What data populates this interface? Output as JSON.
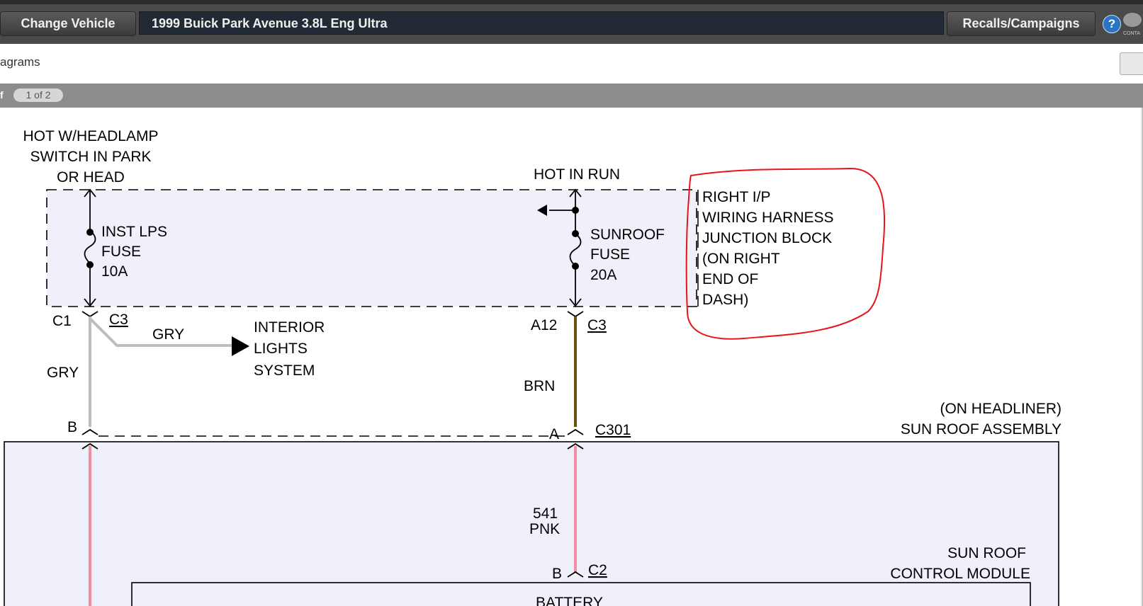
{
  "toolbar": {
    "change_vehicle": "Change Vehicle",
    "vehicle": "1999 Buick Park Avenue 3.8L Eng Ultra",
    "recalls": "Recalls/Campaigns",
    "help": "?",
    "chat_label": "CONTA"
  },
  "subbar": {
    "breadcrumb": "agrams"
  },
  "pager": {
    "label": "f",
    "page": "1 of 2"
  },
  "diagram": {
    "hot_headlamp": [
      "HOT W/HEADLAMP",
      "SWITCH IN PARK",
      "OR HEAD"
    ],
    "hot_in_run": "HOT IN RUN",
    "inst_fuse": [
      "INST LPS",
      "FUSE",
      "10A"
    ],
    "sunroof_fuse": [
      "SUNROOF",
      "FUSE",
      "20A"
    ],
    "junction_block": [
      "RIGHT I/P",
      "WIRING HARNESS",
      "JUNCTION BLOCK",
      "(ON RIGHT",
      "END OF",
      "DASH)"
    ],
    "c1": "C1",
    "c3_left": "C3",
    "gry_branch": "GRY",
    "interior": [
      "INTERIOR",
      "LIGHTS",
      "SYSTEM"
    ],
    "gry_vertical": "GRY",
    "a12": "A12",
    "c3_right": "C3",
    "brn": "BRN",
    "b_left": "B",
    "a_right": "A",
    "c301": "C301",
    "headliner": "(ON HEADLINER)",
    "sunroof_assembly": "SUN ROOF ASSEMBLY",
    "wire_541": "541",
    "pnk": "PNK",
    "sunroof_module": [
      "SUN ROOF",
      "CONTROL MODULE"
    ],
    "b_c2": "B",
    "c2": "C2",
    "battery_partial": "BATTERY"
  },
  "colors": {
    "gry_wire": "#bdbdbd",
    "brn_wire": "#6b4f10",
    "pnk_wire": "#f28da6",
    "annotation": "#e8141b",
    "box_fill": "#f0f0fb"
  }
}
